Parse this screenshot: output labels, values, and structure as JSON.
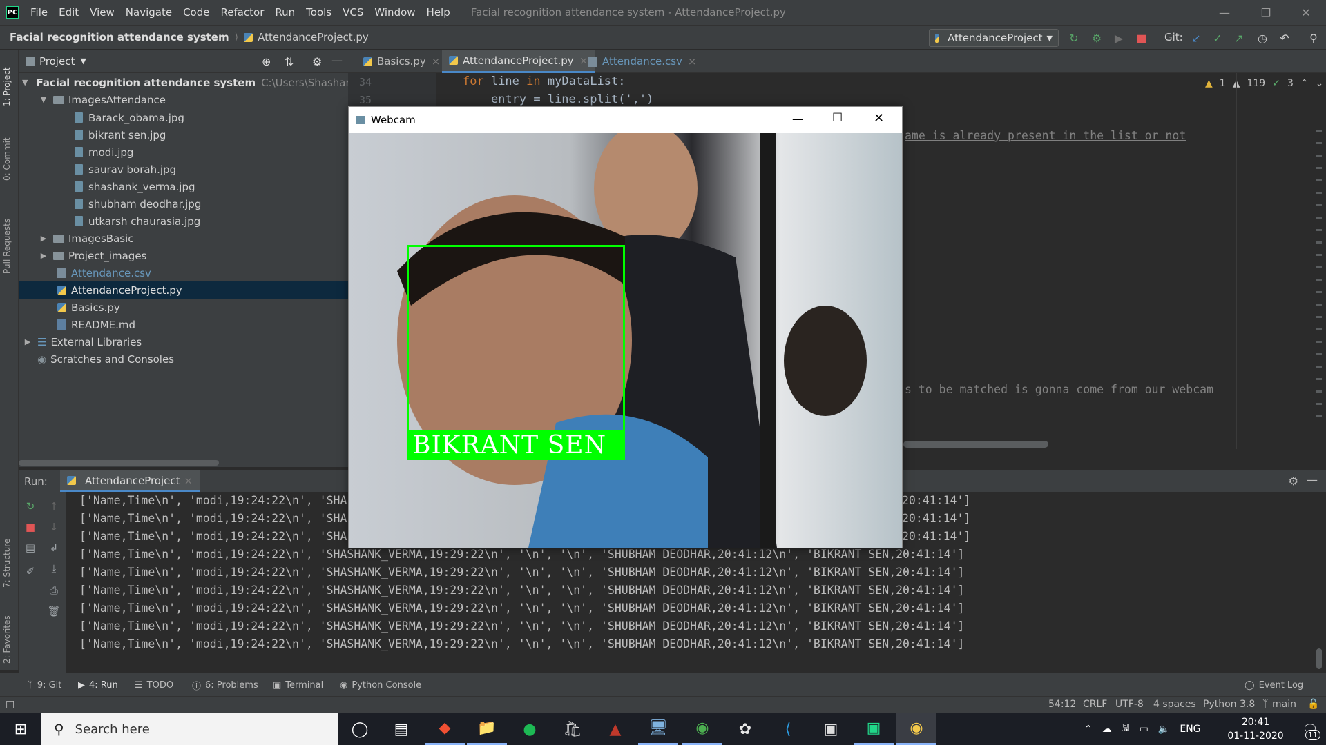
{
  "menu": [
    "File",
    "Edit",
    "View",
    "Navigate",
    "Code",
    "Refactor",
    "Run",
    "Tools",
    "VCS",
    "Window",
    "Help"
  ],
  "window_title": "Facial recognition attendance system - AttendanceProject.py",
  "breadcrumb": {
    "project": "Facial recognition attendance system",
    "file": "AttendanceProject.py"
  },
  "run_config": "AttendanceProject",
  "git_label": "Git:",
  "project_panel": {
    "title": "Project",
    "root": "Facial recognition attendance system",
    "root_path": "C:\\Users\\Shashank Verma",
    "folder_images_attendance": "ImagesAttendance",
    "images": [
      "Barack_obama.jpg",
      "bikrant sen.jpg",
      "modi.jpg",
      "saurav borah.jpg",
      "shashank_verma.jpg",
      "shubham deodhar.jpg",
      "utkarsh chaurasia.jpg"
    ],
    "folder_images_basic": "ImagesBasic",
    "folder_project_images": "Project_images",
    "file_csv": "Attendance.csv",
    "file_attendance_project": "AttendanceProject.py",
    "file_basics": "Basics.py",
    "file_readme": "README.md",
    "external_libraries": "External Libraries",
    "scratches": "Scratches and Consoles"
  },
  "editor_tabs": [
    "Basics.py",
    "AttendanceProject.py",
    "Attendance.csv"
  ],
  "editor": {
    "line_numbers": [
      "34",
      "35"
    ],
    "line34_kw": "for",
    "line34_rest": " line ",
    "line34_kw2": "in",
    "line34_rest2": " myDataList:",
    "line35": "    entry = line.split(',')",
    "comment1": "ame is already present in the list or not",
    "comment2": "s to be matched is gonna come from our webcam",
    "inspections": {
      "warn1": "1",
      "warn2": "119",
      "ok": "3"
    }
  },
  "webcam": {
    "title": "Webcam",
    "label": "BIKRANT SEN"
  },
  "run_panel": {
    "label": "Run:",
    "tab": "AttendanceProject",
    "console_lines": [
      "['Name,Time\\n', 'modi,19:24:22\\n', 'SHA",
      "['Name,Time\\n', 'modi,19:24:22\\n', 'SHA",
      "['Name,Time\\n', 'modi,19:24:22\\n', 'SHA",
      "['Name,Time\\n', 'modi,19:24:22\\n', 'SHASHANK_VERMA,19:29:22\\n', '\\n', '\\n', 'SHUBHAM DEODHAR,20:41:12\\n', 'BIKRANT SEN,20:41:14']",
      "['Name,Time\\n', 'modi,19:24:22\\n', 'SHASHANK_VERMA,19:29:22\\n', '\\n', '\\n', 'SHUBHAM DEODHAR,20:41:12\\n', 'BIKRANT SEN,20:41:14']",
      "['Name,Time\\n', 'modi,19:24:22\\n', 'SHASHANK_VERMA,19:29:22\\n', '\\n', '\\n', 'SHUBHAM DEODHAR,20:41:12\\n', 'BIKRANT SEN,20:41:14']",
      "['Name,Time\\n', 'modi,19:24:22\\n', 'SHASHANK_VERMA,19:29:22\\n', '\\n', '\\n', 'SHUBHAM DEODHAR,20:41:12\\n', 'BIKRANT SEN,20:41:14']",
      "['Name,Time\\n', 'modi,19:24:22\\n', 'SHASHANK_VERMA,19:29:22\\n', '\\n', '\\n', 'SHUBHAM DEODHAR,20:41:12\\n', 'BIKRANT SEN,20:41:14']",
      "['Name,Time\\n', 'modi,19:24:22\\n', 'SHASHANK_VERMA,19:29:22\\n', '\\n', '\\n', 'SHUBHAM DEODHAR,20:41:12\\n', 'BIKRANT SEN,20:41:14']"
    ],
    "console_tails": [
      "20:41:14']",
      "20:41:14']",
      "20:41:14']"
    ]
  },
  "left_stripe": [
    "1: Project",
    "0: Commit",
    "Pull Requests",
    "7: Structure",
    "2: Favorites"
  ],
  "bottom_tools": [
    "9: Git",
    "4: Run",
    "TODO",
    "6: Problems",
    "Terminal",
    "Python Console"
  ],
  "event_log": "Event Log",
  "status_bar": {
    "position": "54:12",
    "line_sep": "CRLF",
    "encoding": "UTF-8",
    "indent": "4 spaces",
    "interpreter": "Python 3.8",
    "branch": "main"
  },
  "taskbar": {
    "search_placeholder": "Search here",
    "lang": "ENG",
    "time": "20:41",
    "date": "01-11-2020",
    "notifications": "11"
  }
}
